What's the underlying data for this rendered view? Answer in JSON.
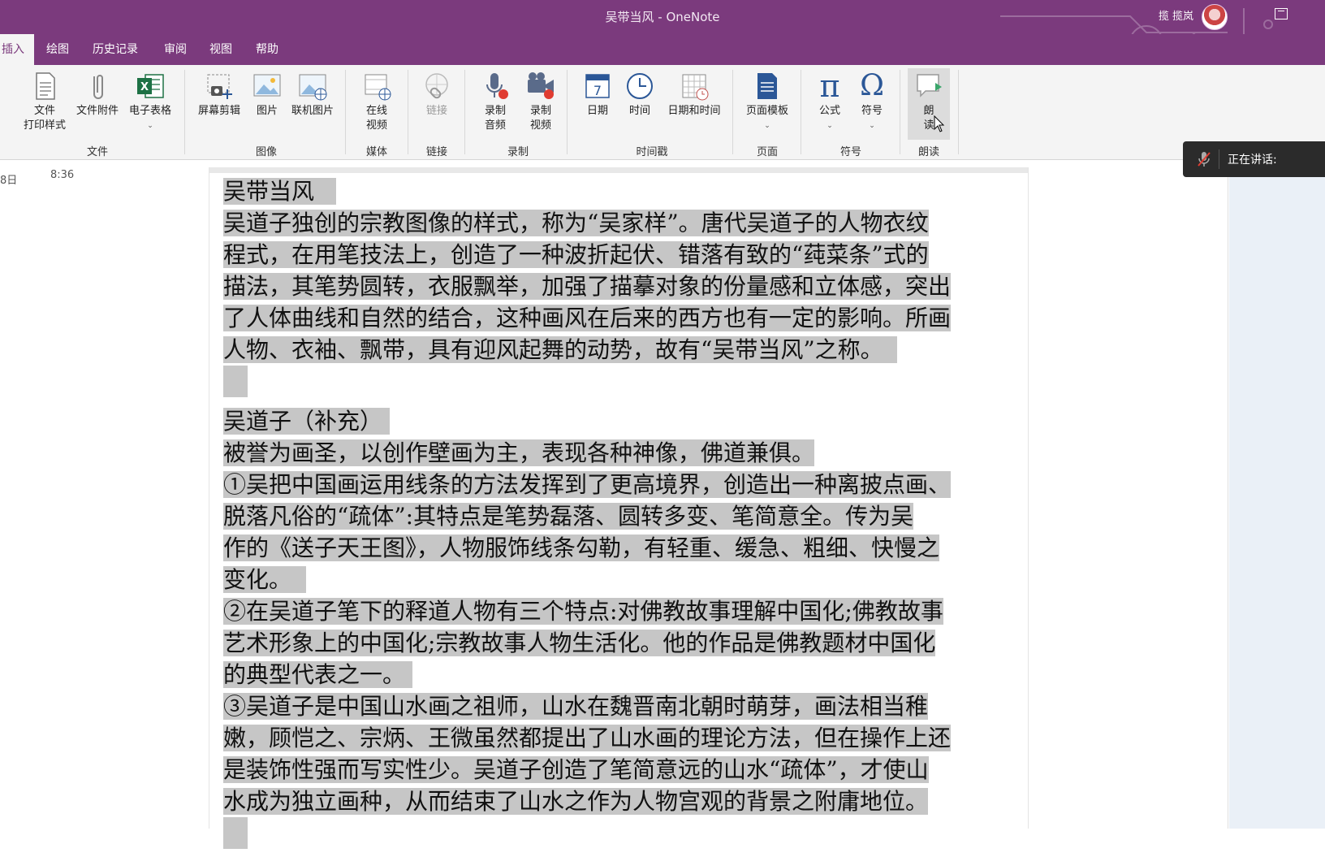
{
  "window": {
    "title": "吴带当风 - OneNote",
    "user": "揽 揽岚"
  },
  "tabs": [
    {
      "label": "插入",
      "active": true
    },
    {
      "label": "绘图"
    },
    {
      "label": "历史记录"
    },
    {
      "label": "审阅"
    },
    {
      "label": "视图"
    },
    {
      "label": "帮助"
    }
  ],
  "ribbon": {
    "file_printout_l1": "文件",
    "file_printout_l2": "打印样式",
    "file_attachment": "文件附件",
    "spreadsheet": "电子表格",
    "screen_clipping": "屏幕剪辑",
    "picture": "图片",
    "online_picture": "联机图片",
    "online_video_l1": "在线",
    "online_video_l2": "视频",
    "link": "链接",
    "record_audio_l1": "录制",
    "record_audio_l2": "音频",
    "record_video_l1": "录制",
    "record_video_l2": "视频",
    "date": "日期",
    "time": "时间",
    "date_time": "日期和时间",
    "page_templates": "页面模板",
    "equation": "公式",
    "symbol": "符号",
    "read_aloud_l1": "朗",
    "read_aloud_l2": "读",
    "calendar_day": "7",
    "groups": {
      "file": "文件",
      "images": "图像",
      "media": "媒体",
      "links": "链接",
      "recording": "录制",
      "timestamp": "时间戳",
      "pages": "页面",
      "symbols": "符号",
      "read": "朗读"
    }
  },
  "page": {
    "date": "8日",
    "time": "8:36"
  },
  "notes": {
    "l1": "吴带当风",
    "l2": "吴道子独创的宗教图像的样式，称为“吴家样”。唐代吴道子的人物衣纹",
    "l3": "程式，在用笔技法上，创造了一种波折起伏、错落有致的“莼菜条”式的",
    "l4": "描法，其笔势圆转，衣服飘举，加强了描摹对象的份量感和立体感，突出",
    "l5": "了人体曲线和自然的结合，这种画风在后来的西方也有一定的影响。所画",
    "l6": "人物、衣袖、飘带，具有迎风起舞的动势，故有“吴带当风”之称。",
    "l8": "吴道子（补充）",
    "l9": "被誉为画圣，以创作壁画为主，表现各种神像，佛道兼俱。",
    "l10": "①吴把中国画运用线条的方法发挥到了更高境界，创造出一种离披点画、",
    "l11": "脱落凡俗的“疏体”:其特点是笔势磊落、圆转多变、笔简意全。传为吴",
    "l12": "作的《送子天王图》，人物服饰线条勾勒，有轻重、缓急、粗细、快慢之",
    "l13": "变化。",
    "l14": "②在吴道子笔下的释道人物有三个特点:对佛教故事理解中国化;佛教故事",
    "l15": "艺术形象上的中国化;宗教故事人物生活化。他的作品是佛教题材中国化",
    "l16": "的典型代表之一。",
    "l17": "③吴道子是中国山水画之祖师，山水在魏晋南北朝时萌芽，画法相当稚",
    "l18": "嫩，顾恺之、宗炳、王微虽然都提出了山水画的理论方法，但在操作上还",
    "l19": "是装饰性强而写实性少。吴道子创造了笔简意远的山水“疏体”，才使山",
    "l20": "水成为独立画种，从而结束了山水之作为人物宫观的背景之附庸地位。"
  },
  "speaking": {
    "label": "正在讲话:"
  },
  "colors": {
    "accent": "#7b3a7d",
    "selection": "#c6c6c6",
    "ribbon_bg": "#f4f4f4"
  }
}
